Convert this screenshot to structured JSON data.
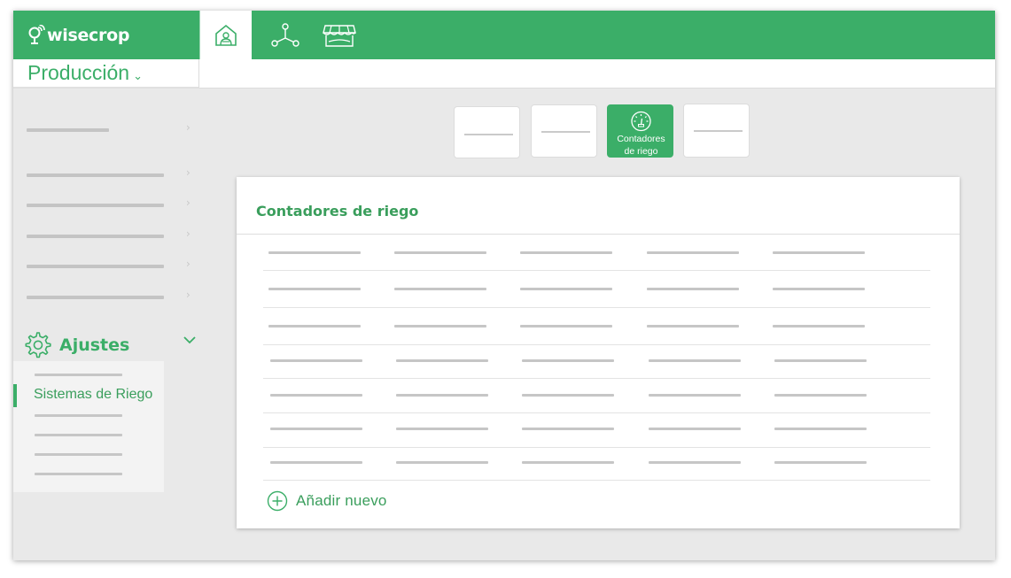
{
  "app": {
    "brand": "wisecrop",
    "brand_color": "#3bae68"
  },
  "topnav": {
    "items": [
      {
        "icon": "farm-home-icon",
        "active": true
      },
      {
        "icon": "network-icon",
        "active": false
      },
      {
        "icon": "market-store-icon",
        "active": false
      }
    ]
  },
  "section": {
    "title": "Producción",
    "chevron": "⌄"
  },
  "sidebar": {
    "chevron": "›",
    "settings_label": "Ajustes",
    "settings_icon": "gear-icon",
    "active_item": "Sistemas de Riego"
  },
  "tiles": [
    {
      "active": false
    },
    {
      "active": false
    },
    {
      "active": true,
      "label": "Contadores\nde riego",
      "icon": "gauge-icon"
    },
    {
      "active": false
    }
  ],
  "card": {
    "title": "Contadores de riego",
    "rows": 7,
    "add_label": "Añadir nuevo"
  }
}
